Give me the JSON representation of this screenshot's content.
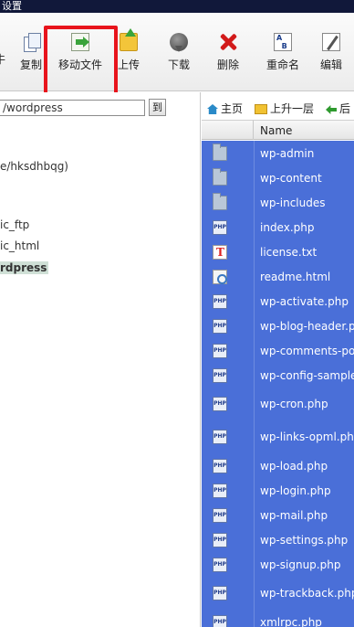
{
  "menu_bar": {
    "title": "设置"
  },
  "toolbar": {
    "buttons": [
      {
        "label": "牛",
        "icon": "cut-icon"
      },
      {
        "label": "复制",
        "icon": "copy-icon"
      },
      {
        "label": "移动文件",
        "icon": "move-file-icon"
      },
      {
        "label": "上传",
        "icon": "upload-icon"
      },
      {
        "label": "下载",
        "icon": "download-icon"
      },
      {
        "label": "删除",
        "icon": "delete-icon"
      },
      {
        "label": "重命名",
        "icon": "rename-icon"
      },
      {
        "label": "编辑",
        "icon": "edit-icon"
      }
    ],
    "highlighted": "移动文件"
  },
  "left_pane": {
    "path_value": "/wordpress",
    "go_label": "到",
    "tree": [
      {
        "label": "e/hksdhbqg)",
        "selected": false
      },
      {
        "label": "ic_ftp",
        "selected": false
      },
      {
        "label": "ic_html",
        "selected": false
      },
      {
        "label": "rdpress",
        "selected": true
      }
    ]
  },
  "right_pane": {
    "nav": {
      "home": "主页",
      "up": "上升一层",
      "back": "后"
    },
    "column_header": "Name",
    "files": [
      {
        "name": "wp-admin",
        "type": "folder"
      },
      {
        "name": "wp-content",
        "type": "folder"
      },
      {
        "name": "wp-includes",
        "type": "folder"
      },
      {
        "name": "index.php",
        "type": "php"
      },
      {
        "name": "license.txt",
        "type": "txt"
      },
      {
        "name": "readme.html",
        "type": "html"
      },
      {
        "name": "wp-activate.php",
        "type": "php"
      },
      {
        "name": "wp-blog-header.ph",
        "type": "php"
      },
      {
        "name": "wp-comments-post",
        "type": "php"
      },
      {
        "name": "wp-config-sample.p",
        "type": "php"
      },
      {
        "name": "wp-cron.php",
        "type": "php"
      },
      {
        "name": "wp-links-opml.php",
        "type": "php"
      },
      {
        "name": "wp-load.php",
        "type": "php"
      },
      {
        "name": "wp-login.php",
        "type": "php"
      },
      {
        "name": "wp-mail.php",
        "type": "php"
      },
      {
        "name": "wp-settings.php",
        "type": "php"
      },
      {
        "name": "wp-signup.php",
        "type": "php"
      },
      {
        "name": "wp-trackback.php",
        "type": "php"
      },
      {
        "name": "xmlrpc.php",
        "type": "php"
      }
    ],
    "php_icon_text": "PHP"
  },
  "colors": {
    "selection_blue": "#4a6fd8",
    "highlight_red": "#e8141c",
    "topbar": "#11183a"
  }
}
